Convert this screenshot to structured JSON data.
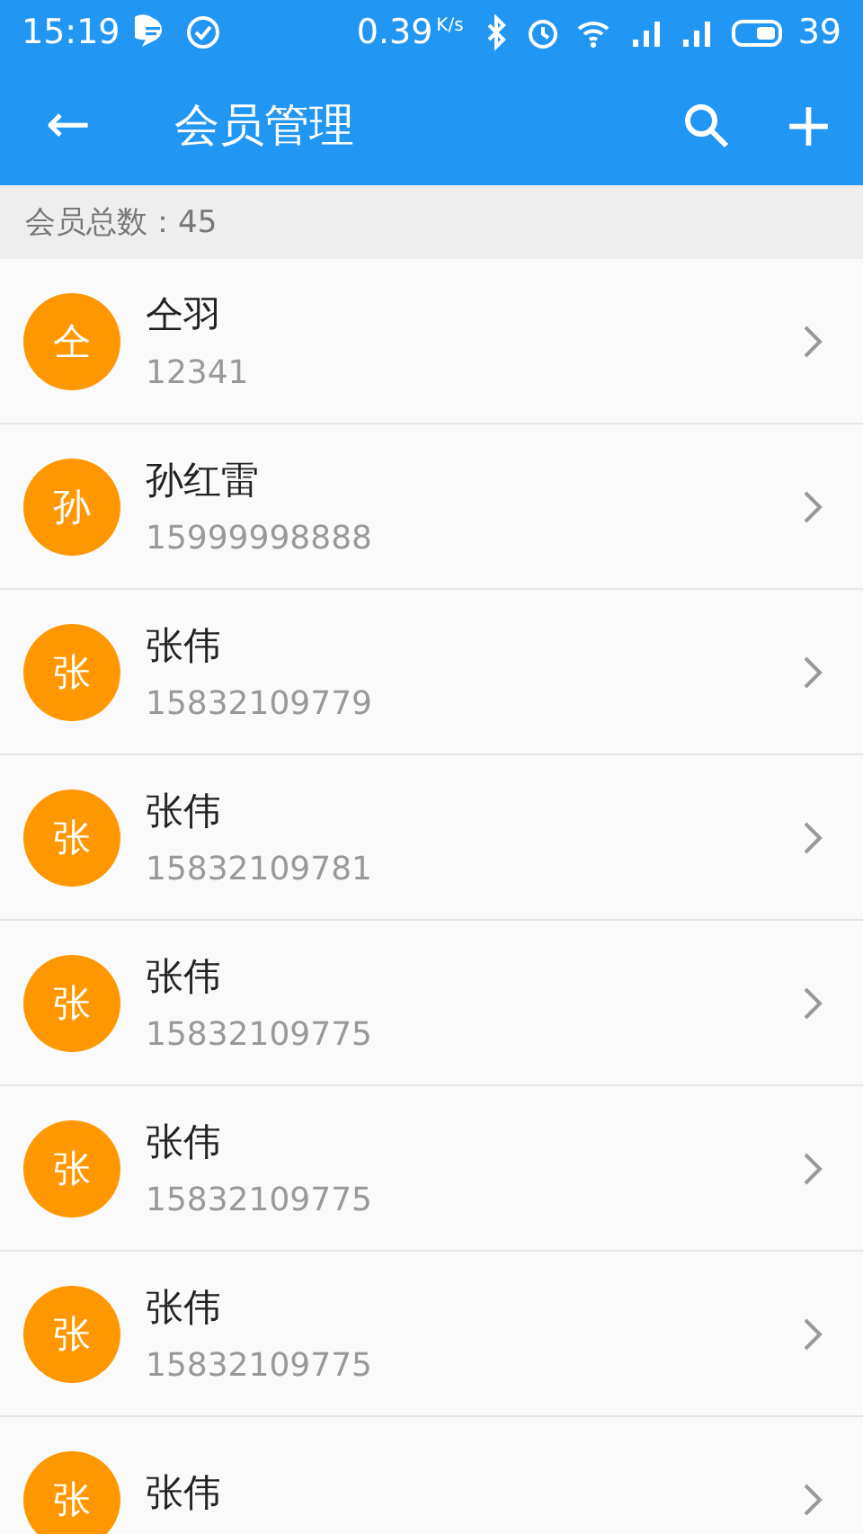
{
  "status_bar": {
    "time": "15:19",
    "speed": "0.39",
    "speed_unit": "K/s",
    "battery": "39"
  },
  "toolbar": {
    "back": "←",
    "title": "会员管理",
    "add": "+"
  },
  "summary": "会员总数：45",
  "members": [
    {
      "avatar": "仝",
      "name": "仝羽",
      "phone": "12341"
    },
    {
      "avatar": "孙",
      "name": "孙红雷",
      "phone": "15999998888"
    },
    {
      "avatar": "张",
      "name": "张伟",
      "phone": "15832109779"
    },
    {
      "avatar": "张",
      "name": "张伟",
      "phone": "15832109781"
    },
    {
      "avatar": "张",
      "name": "张伟",
      "phone": "15832109775"
    },
    {
      "avatar": "张",
      "name": "张伟",
      "phone": "15832109775"
    },
    {
      "avatar": "张",
      "name": "张伟",
      "phone": "15832109775"
    },
    {
      "avatar": "张",
      "name": "张伟"
    }
  ]
}
